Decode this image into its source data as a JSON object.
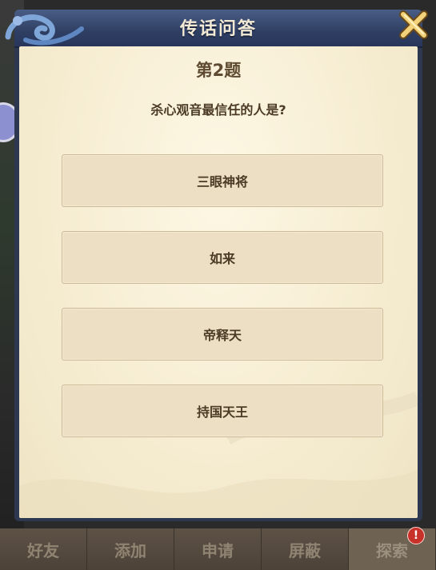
{
  "dialog": {
    "title": "传话问答",
    "question_number": "第2题",
    "question": "杀心观音最信任的人是?",
    "options": [
      "三眼神将",
      "如来",
      "帝释天",
      "持国天王"
    ]
  },
  "tabbar": {
    "tabs": [
      "好友",
      "添加",
      "申请",
      "屏蔽",
      "探索"
    ],
    "active_index": 4,
    "badge": "!"
  },
  "colors": {
    "title_bar": "#2f3f63",
    "paper": "#f6edd2",
    "option_bg": "#ecdfc3",
    "text_dark": "#4b3a25",
    "badge_red": "#c8302a"
  }
}
